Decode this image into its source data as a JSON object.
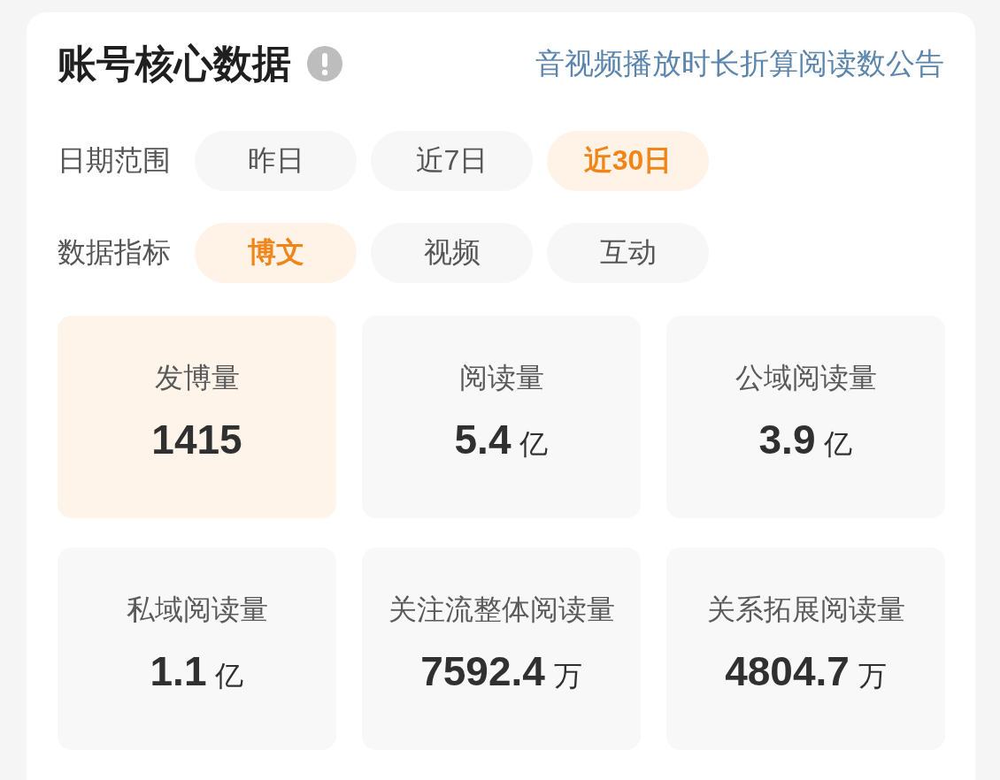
{
  "header": {
    "title": "账号核心数据",
    "link": "音视频播放时长折算阅读数公告"
  },
  "filters": [
    {
      "label": "日期范围",
      "options": [
        {
          "text": "昨日",
          "selected": false
        },
        {
          "text": "近7日",
          "selected": false
        },
        {
          "text": "近30日",
          "selected": true
        }
      ]
    },
    {
      "label": "数据指标",
      "options": [
        {
          "text": "博文",
          "selected": true
        },
        {
          "text": "视频",
          "selected": false
        },
        {
          "text": "互动",
          "selected": false
        }
      ]
    }
  ],
  "metrics": [
    {
      "label": "发博量",
      "value": "1415",
      "selected": true
    },
    {
      "label": "阅读量",
      "value": "5.4",
      "unit": "亿",
      "selected": false
    },
    {
      "label": "公域阅读量",
      "value": "3.9",
      "unit": "亿",
      "selected": false
    },
    {
      "label": "私域阅读量",
      "value": "1.1",
      "unit": "亿",
      "selected": false
    },
    {
      "label": "关注流整体阅读量",
      "value": "7592.4",
      "unit": "万",
      "selected": false
    },
    {
      "label": "关系拓展阅读量",
      "value": "4804.7",
      "unit": "万",
      "selected": false
    }
  ]
}
